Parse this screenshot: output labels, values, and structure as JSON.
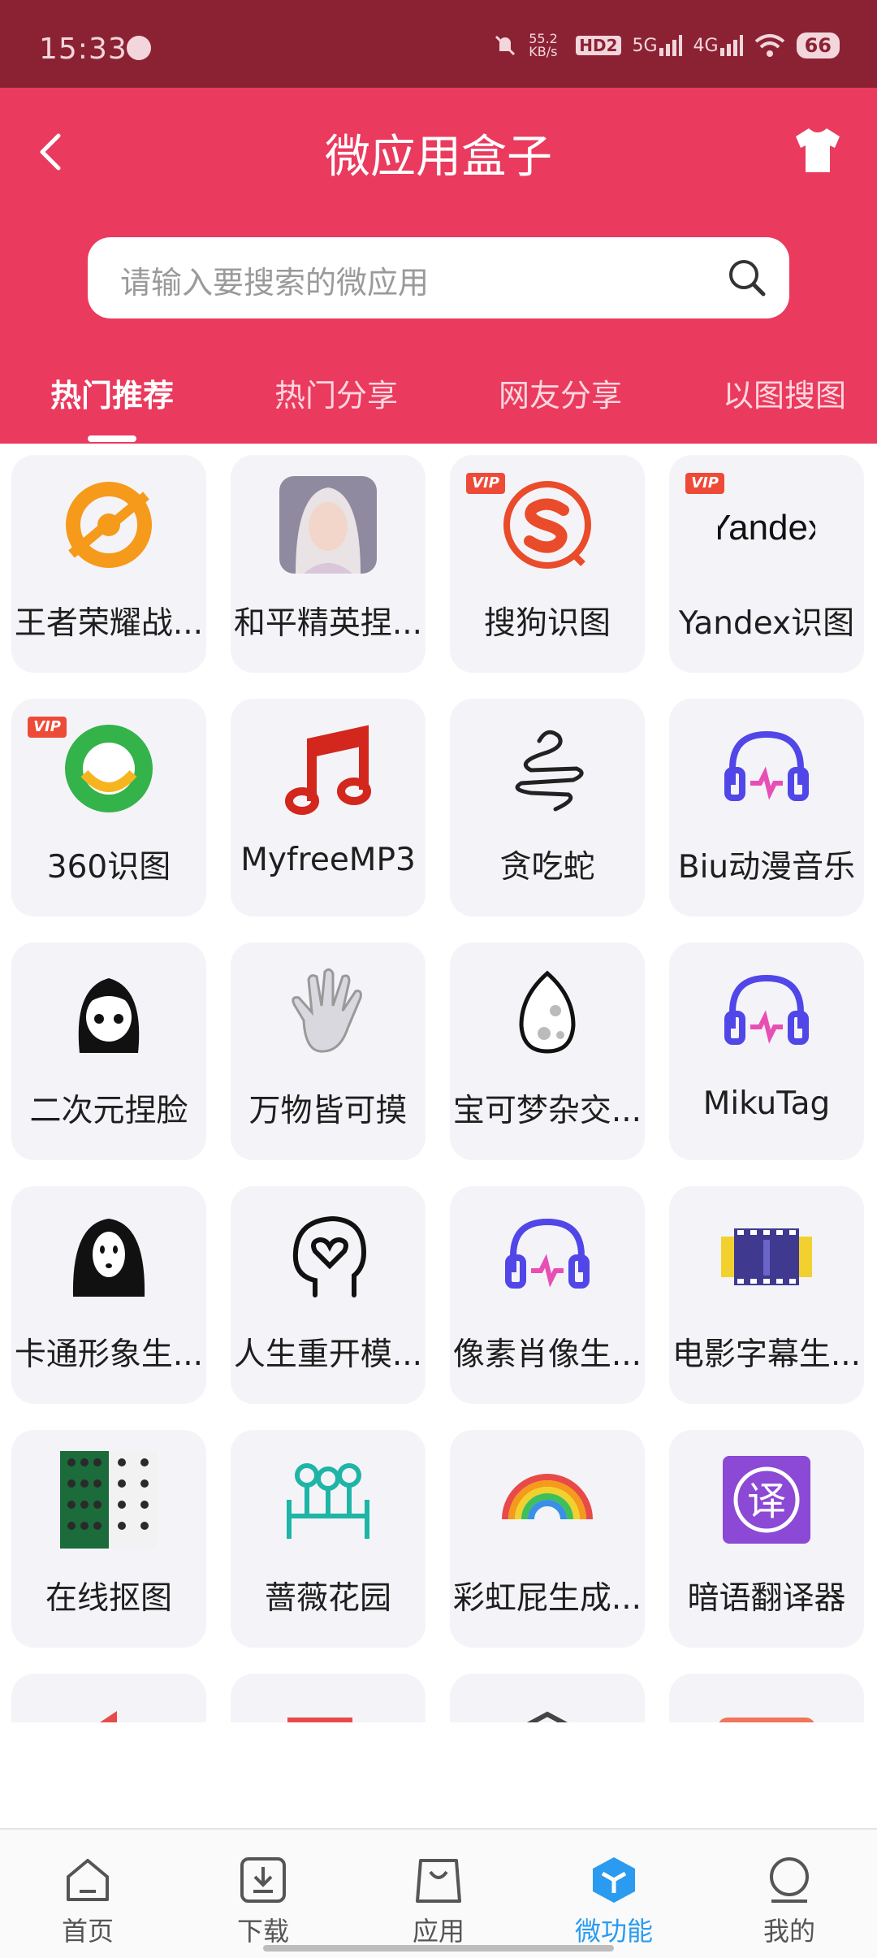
{
  "status_bar": {
    "time": "15:33",
    "net_speed": "55.2 KB/s",
    "hd": "HD2",
    "signal_1": "5G",
    "signal_2": "4G",
    "battery": "66"
  },
  "header": {
    "title": "微应用盒子",
    "search_placeholder": "请输入要搜索的微应用",
    "accent": "#ea3a5e"
  },
  "tabs": [
    {
      "label": "热门推荐",
      "active": true
    },
    {
      "label": "热门分享",
      "active": false
    },
    {
      "label": "网友分享",
      "active": false
    },
    {
      "label": "以图搜图",
      "active": false
    }
  ],
  "apps": [
    {
      "label": "王者荣耀战...",
      "icon": "honor-of-kings-icon",
      "vip": false
    },
    {
      "label": "和平精英捏...",
      "icon": "character-avatar-icon",
      "vip": false
    },
    {
      "label": "搜狗识图",
      "icon": "sogou-icon",
      "vip": true
    },
    {
      "label": "Yandex识图",
      "icon": "yandex-icon",
      "vip": true
    },
    {
      "label": "360识图",
      "icon": "360-icon",
      "vip": true
    },
    {
      "label": "MyfreeMP3",
      "icon": "music-note-icon",
      "vip": false
    },
    {
      "label": "贪吃蛇",
      "icon": "snake-icon",
      "vip": false
    },
    {
      "label": "Biu动漫音乐",
      "icon": "headphones-icon",
      "vip": false
    },
    {
      "label": "二次元捏脸",
      "icon": "anime-girl-icon",
      "vip": false
    },
    {
      "label": "万物皆可摸",
      "icon": "hand-icon",
      "vip": false
    },
    {
      "label": "宝可梦杂交...",
      "icon": "egg-icon",
      "vip": false
    },
    {
      "label": "MikuTag",
      "icon": "headphones-icon",
      "vip": false
    },
    {
      "label": "卡通形象生...",
      "icon": "ghost-face-icon",
      "vip": false
    },
    {
      "label": "人生重开模...",
      "icon": "head-heart-icon",
      "vip": false
    },
    {
      "label": "像素肖像生...",
      "icon": "headphones-icon",
      "vip": false
    },
    {
      "label": "电影字幕生...",
      "icon": "film-strip-icon",
      "vip": false
    },
    {
      "label": "在线抠图",
      "icon": "cutout-grid-icon",
      "vip": false
    },
    {
      "label": "蔷薇花园",
      "icon": "garden-icon",
      "vip": false
    },
    {
      "label": "彩虹屁生成...",
      "icon": "rainbow-icon",
      "vip": false
    },
    {
      "label": "暗语翻译器",
      "icon": "translate-icon",
      "vip": false
    }
  ],
  "vip_badge": "VIP",
  "bottom_nav": [
    {
      "label": "首页",
      "icon": "home-icon",
      "active": false
    },
    {
      "label": "下载",
      "icon": "download-icon",
      "active": false
    },
    {
      "label": "应用",
      "icon": "bag-icon",
      "active": false
    },
    {
      "label": "微功能",
      "icon": "cube-icon",
      "active": true
    },
    {
      "label": "我的",
      "icon": "profile-icon",
      "active": false
    }
  ]
}
